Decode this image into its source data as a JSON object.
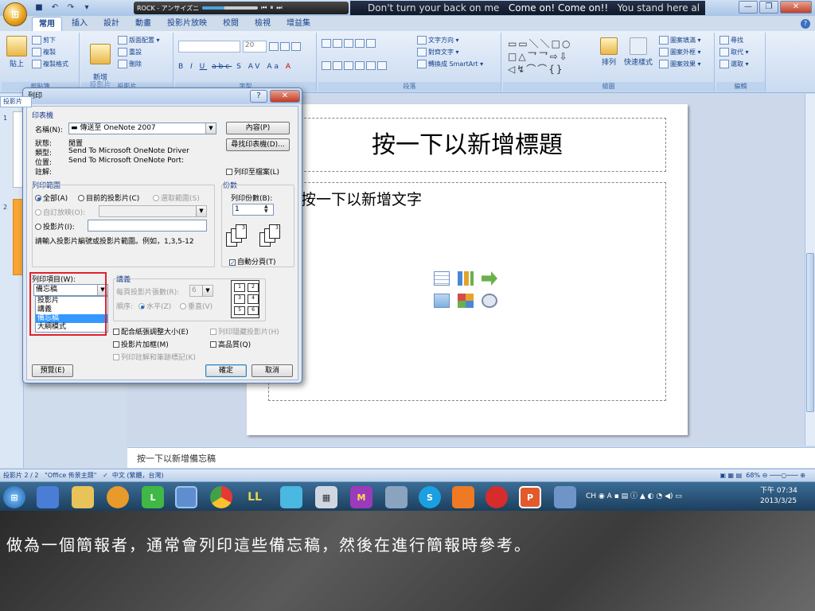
{
  "titlebar": {
    "media_title": "ROCK - アンサイズニ",
    "lyrics_pre": "Don't turn your back on me",
    "lyrics_cur": "Come on! Come on!!",
    "lyrics_post": "You stand here al"
  },
  "quick_access": [
    "save-icon",
    "undo-icon",
    "redo-icon"
  ],
  "ribbon_tabs": [
    {
      "label": "常用",
      "active": true
    },
    {
      "label": "插入"
    },
    {
      "label": "設計"
    },
    {
      "label": "動畫"
    },
    {
      "label": "投影片放映"
    },
    {
      "label": "校閱"
    },
    {
      "label": "檢視"
    },
    {
      "label": "增益集"
    }
  ],
  "ribbon": {
    "clipboard": {
      "paste": "貼上",
      "cut": "剪下",
      "copy": "複製",
      "format_painter": "複製格式",
      "label": "剪貼簿"
    },
    "slides": {
      "new_slide": "新增\n投影片",
      "layout": "版面配置",
      "reset": "重設",
      "delete": "刪除",
      "label": "投影片"
    },
    "font": {
      "size": "20",
      "label": "字型"
    },
    "paragraph": {
      "text_direction": "文字方向",
      "align_text": "對齊文字",
      "smartart": "轉換成 SmartArt",
      "label": "段落"
    },
    "drawing": {
      "arrange": "排列",
      "quick_styles": "快速樣式",
      "shape_fill": "圖案填滿",
      "shape_outline": "圖案外框",
      "shape_effects": "圖案效果",
      "label": "繪圖"
    },
    "editing": {
      "find": "尋找",
      "replace": "取代",
      "select": "選取",
      "label": "編輯"
    }
  },
  "pane": {
    "tab_label": "投影片",
    "slides": [
      "1",
      "2"
    ]
  },
  "slide": {
    "title_placeholder": "按一下以新增標題",
    "body_placeholder": "按一下以新增文字"
  },
  "notes_placeholder": "按一下以新增備忘稿",
  "status": {
    "slide_info": "投影片 2 / 2",
    "theme": "\"Office 佈景主題\"",
    "language": "中文 (繁體，台灣)",
    "zoom": "68%"
  },
  "dialog": {
    "title": "列印",
    "printer_section": "印表機",
    "name_label": "名稱(N):",
    "printer_name": "傳送至 OneNote 2007",
    "properties_btn": "內容(P)",
    "find_printer_btn": "尋找印表機(D)...",
    "status_label": "狀態:",
    "status_value": "閒置",
    "type_label": "類型:",
    "type_value": "Send To Microsoft OneNote Driver",
    "where_label": "位置:",
    "where_value": "Send To Microsoft OneNote Port:",
    "comment_label": "註解:",
    "print_to_file": "列印至檔案(L)",
    "range_section": "列印範圍",
    "range_all": "全部(A)",
    "range_current": "目前的投影片(C)",
    "range_selection": "選取範圍(S)",
    "range_custom_show": "自訂放映(O):",
    "range_slides": "投影片(I):",
    "range_hint": "請輸入投影片編號或投影片範圍。例如，1,3,5-12",
    "copies_section": "份數",
    "copies_label": "列印份數(B):",
    "copies_value": "1",
    "collate": "自動分頁(T)",
    "print_what_label": "列印項目(W):",
    "print_what_value": "備忘稿",
    "print_what_options": [
      "投影片",
      "講義",
      "備忘稿",
      "大綱模式"
    ],
    "print_what_selected": "備忘稿",
    "handouts_section": "講義",
    "per_page_label": "每頁投影片張數(R):",
    "per_page_value": "6",
    "order_label": "順序:",
    "order_horizontal": "水平(Z)",
    "order_vertical": "垂直(V)",
    "handout_nums": [
      "1",
      "2",
      "3",
      "4",
      "5",
      "6"
    ],
    "scale_to_fit": "配合紙張調整大小(E)",
    "frame_slides": "投影片加框(M)",
    "print_comments": "列印註解和筆跡標記(K)",
    "print_hidden": "列印隱藏投影片(H)",
    "high_quality": "高品質(Q)",
    "preview_btn": "預覽(E)",
    "ok_btn": "確定",
    "cancel_btn": "取消"
  },
  "taskbar": {
    "apps": [
      "start-orb",
      "app-icon",
      "folder-icon",
      "browser-icon",
      "line-icon",
      "firefox-icon",
      "chrome-icon",
      "app-icon",
      "app-icon",
      "calc-icon",
      "app-icon",
      "app-icon",
      "skype-icon",
      "app-icon",
      "app-icon",
      "powerpoint-icon",
      "app-icon"
    ],
    "ime": "CH",
    "time": "下午 07:34",
    "date": "2013/3/25"
  },
  "caption": "做為一個簡報者，通常會列印這些備忘稿，然後在進行簡報時參考。"
}
